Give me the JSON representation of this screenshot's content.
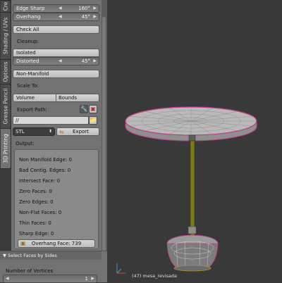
{
  "tabs": {
    "create": "Cre",
    "shading_uvs": "Shading / UVs",
    "options": "Options",
    "grease_pencil": "Grease Pencil",
    "printing": "3D Printing"
  },
  "panel": {
    "edge_sharp": {
      "label": "Edge Sharp",
      "value": "160°"
    },
    "overhang": {
      "label": "Overhang",
      "value": "45°"
    },
    "check_all": "Check All",
    "cleanup_label": "Cleanup:",
    "isolated": "Isolated",
    "distorted": {
      "label": "Distorted",
      "value": "45°"
    },
    "non_manifold": "Non-Manifold",
    "scale_to_label": "Scale To:",
    "volume": "Volume",
    "bounds": "Bounds",
    "export_path_label": "Export Path:",
    "export_path_value": "//",
    "format": "STL",
    "export_button": "Export",
    "output_label": "Output:",
    "output_lines": [
      "Non Manifold Edge: 0",
      "Bad Contig. Edges: 0",
      "Intersect Face: 0",
      "Zero Faces: 0",
      "Zero Edges: 0",
      "Non-Flat Faces: 0",
      "Thin Faces: 0",
      "Sharp Edge: 0"
    ],
    "overhang_face": "Overhang Face: 739"
  },
  "bottom_panel": {
    "header": "Select Faces by Sides",
    "number_of_vertices_label": "Number of Vertices",
    "vertices_value": "1"
  },
  "viewport": {
    "object_label": "(47) mesa_revisada"
  },
  "colors": {
    "panel_bg": "#727272",
    "viewport_bg": "#393939",
    "mesh_highlight": "#c8368a",
    "stem": "#7a7a1a"
  }
}
